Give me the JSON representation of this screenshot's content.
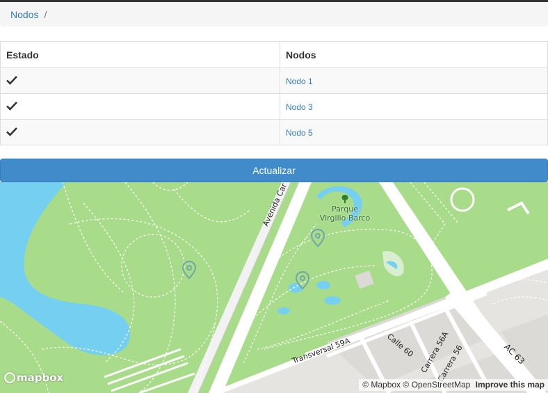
{
  "breadcrumb": {
    "link": "Nodos",
    "separator": "/"
  },
  "table": {
    "headers": {
      "state": "Estado",
      "nodes": "Nodos"
    },
    "rows": [
      {
        "state_icon": "check-icon",
        "node": "Nodo 1"
      },
      {
        "state_icon": "check-icon",
        "node": "Nodo 3"
      },
      {
        "state_icon": "check-icon",
        "node": "Nodo 5"
      }
    ]
  },
  "update_button": {
    "label": "Actualizar"
  },
  "map": {
    "logo": "mapbox",
    "attribution": {
      "mapbox": "© Mapbox",
      "osm": "© OpenStreetMap",
      "improve": "Improve this map"
    },
    "labels": {
      "avenida": "Avenida Car",
      "park_line1": "Parque",
      "park_line2": "Virgilio Barco",
      "transversal": "Transversal 59A",
      "calle60": "Calle 60",
      "carrera56a": "Carrera 56A",
      "carrera56": "Carrera 56",
      "ac63": "AC 63"
    },
    "markers": [
      "marker-icon",
      "marker-icon",
      "marker-icon"
    ],
    "colors": {
      "park": "#a9dc8a",
      "water": "#75cff0",
      "road": "#ffffff",
      "urban": "#e6e4e0"
    }
  }
}
